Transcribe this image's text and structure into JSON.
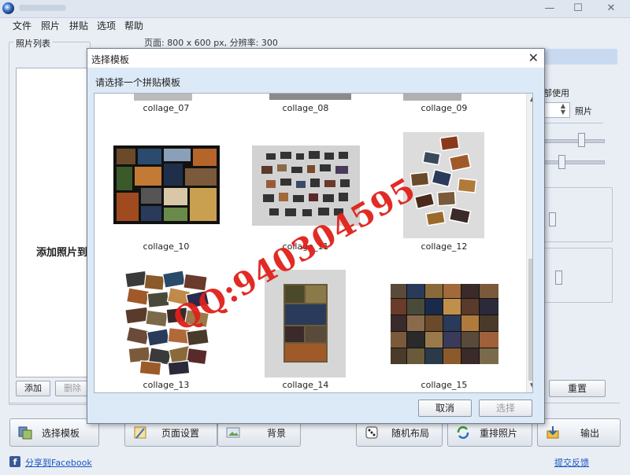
{
  "menu": {
    "items": [
      "文件",
      "照片",
      "拼贴",
      "选项",
      "帮助"
    ]
  },
  "window_controls": [
    "—",
    "☐",
    "✕"
  ],
  "page_info": "页面: 800 x 600 px, 分辨率: 300",
  "photo_list": {
    "label": "照片列表",
    "hint": "添加照片到",
    "add": "添加",
    "delete": "删除"
  },
  "right_panel": {
    "use_label": "部使用",
    "photo_label": "照片",
    "reset": "重置"
  },
  "dialog": {
    "title": "选择模板",
    "prompt": "请选择一个拼贴模板",
    "cancel": "取消",
    "select": "选择",
    "templates_top": [
      "collage_07",
      "collage_08",
      "collage_09"
    ],
    "templates_mid": [
      "collage_10",
      "collage_11",
      "collage_12"
    ],
    "templates_bot": [
      "collage_13",
      "collage_14",
      "collage_15"
    ]
  },
  "bottom_buttons": {
    "select_template": "选择模板",
    "page_setup": "页面设置",
    "background": "背景",
    "random_layout": "随机布局",
    "rearrange": "重排照片",
    "output": "输出"
  },
  "footer": {
    "share": "分享到Facebook",
    "feedback": "提交反馈"
  },
  "watermark": "QQ:940304595",
  "colors": {
    "accent": "#3b5998",
    "link": "#1a55c0",
    "watermark": "#e0201a"
  }
}
